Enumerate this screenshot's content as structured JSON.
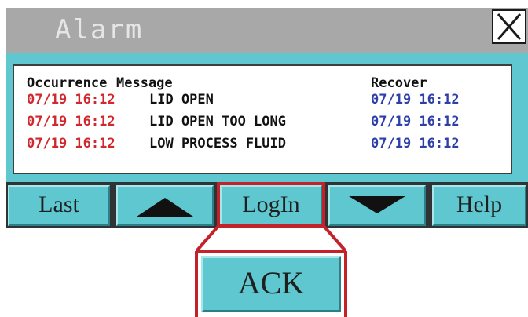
{
  "window": {
    "title": "Alarm",
    "close_icon": "close-x-icon"
  },
  "alarm_list": {
    "headers": {
      "occurrence": "Occurrence",
      "message": "Message",
      "recover": "Recover"
    },
    "rows": [
      {
        "occurrence": "07/19 16:12",
        "message": "LID OPEN",
        "recover": "07/19 16:12"
      },
      {
        "occurrence": "07/19 16:12",
        "message": "LID OPEN TOO LONG",
        "recover": "07/19 16:12"
      },
      {
        "occurrence": "07/19 16:12",
        "message": "LOW PROCESS FLUID",
        "recover": "07/19 16:12"
      }
    ]
  },
  "toolbar": {
    "last_label": "Last",
    "up_icon": "triangle-up-icon",
    "login_label": "LogIn",
    "down_icon": "triangle-down-icon",
    "help_label": "Help"
  },
  "callout": {
    "ack_label": "ACK"
  },
  "colors": {
    "title_bar": "#a8a8a8",
    "button_face": "#5ec7cf",
    "occurrence_text": "#d0282e",
    "recover_text": "#2e3fa8",
    "highlight": "#c2232b"
  }
}
